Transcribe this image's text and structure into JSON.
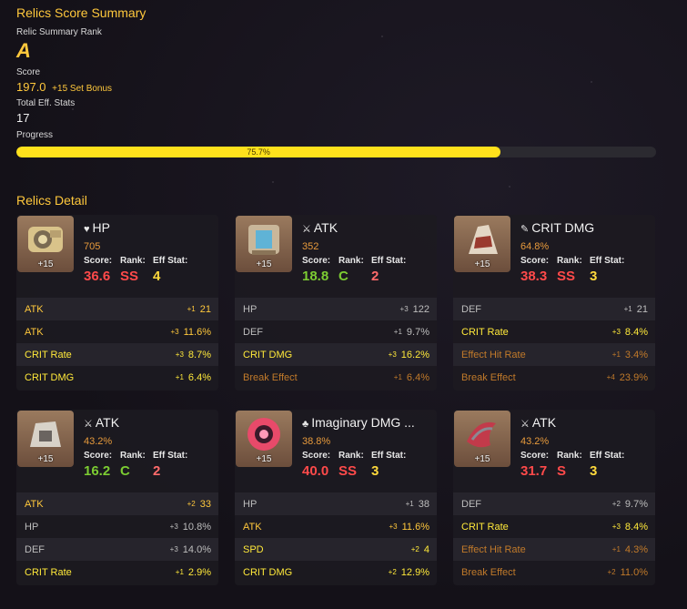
{
  "summary": {
    "title": "Relics Score Summary",
    "rank_label": "Relic Summary Rank",
    "rank": "A",
    "score_label": "Score",
    "score": "197.0",
    "set_bonus": "+15 Set Bonus",
    "eff_label": "Total Eff. Stats",
    "eff_value": "17",
    "progress_label": "Progress",
    "progress_text": "75.7%",
    "progress_fraction": 0.757
  },
  "detail": {
    "title": "Relics Detail",
    "score_hdr": "Score:",
    "rank_hdr": "Rank:",
    "eff_hdr": "Eff Stat:"
  },
  "colors": {
    "accent": "#ffc83c",
    "progress": "#ffe11c"
  },
  "relics": [
    {
      "icon": "heart-icon",
      "icon_glyph": "♥",
      "main": "HP",
      "main_value": "705",
      "level": "+15",
      "score": "36.6",
      "rank": "SS",
      "eff": "4",
      "score_color": "red",
      "rank_color": "red",
      "eff_color": "yellow",
      "subs": [
        {
          "name": "ATK",
          "rolls": "+1",
          "value": "21",
          "color": "gold"
        },
        {
          "name": "ATK",
          "rolls": "+3",
          "value": "11.6%",
          "color": "gold"
        },
        {
          "name": "CRIT Rate",
          "rolls": "+3",
          "value": "8.7%",
          "color": "yellow"
        },
        {
          "name": "CRIT DMG",
          "rolls": "+1",
          "value": "6.4%",
          "color": "yellow"
        }
      ]
    },
    {
      "icon": "sword-icon",
      "icon_glyph": "⚔",
      "main": "ATK",
      "main_value": "352",
      "level": "+15",
      "score": "18.8",
      "rank": "C",
      "eff": "2",
      "score_color": "green",
      "rank_color": "green",
      "eff_color": "pink",
      "subs": [
        {
          "name": "HP",
          "rolls": "+3",
          "value": "122",
          "color": "grey"
        },
        {
          "name": "DEF",
          "rolls": "+1",
          "value": "9.7%",
          "color": "grey"
        },
        {
          "name": "CRIT DMG",
          "rolls": "+3",
          "value": "16.2%",
          "color": "yellow"
        },
        {
          "name": "Break Effect",
          "rolls": "+1",
          "value": "6.4%",
          "color": "dim"
        }
      ]
    },
    {
      "icon": "crit-dmg-icon",
      "icon_glyph": "✎",
      "main": "CRIT DMG",
      "main_value": "64.8%",
      "level": "+15",
      "score": "38.3",
      "rank": "SS",
      "eff": "3",
      "score_color": "red",
      "rank_color": "red",
      "eff_color": "yellow",
      "subs": [
        {
          "name": "DEF",
          "rolls": "+1",
          "value": "21",
          "color": "grey"
        },
        {
          "name": "CRIT Rate",
          "rolls": "+3",
          "value": "8.4%",
          "color": "yellow"
        },
        {
          "name": "Effect Hit Rate",
          "rolls": "+1",
          "value": "3.4%",
          "color": "dim"
        },
        {
          "name": "Break Effect",
          "rolls": "+4",
          "value": "23.9%",
          "color": "dim"
        }
      ]
    },
    {
      "icon": "sword-icon",
      "icon_glyph": "⚔",
      "main": "ATK",
      "main_value": "43.2%",
      "level": "+15",
      "score": "16.2",
      "rank": "C",
      "eff": "2",
      "score_color": "green",
      "rank_color": "green",
      "eff_color": "pink",
      "subs": [
        {
          "name": "ATK",
          "rolls": "+2",
          "value": "33",
          "color": "gold"
        },
        {
          "name": "HP",
          "rolls": "+3",
          "value": "10.8%",
          "color": "grey"
        },
        {
          "name": "DEF",
          "rolls": "+3",
          "value": "14.0%",
          "color": "grey"
        },
        {
          "name": "CRIT Rate",
          "rolls": "+1",
          "value": "2.9%",
          "color": "yellow"
        }
      ]
    },
    {
      "icon": "imaginary-icon",
      "icon_glyph": "♣",
      "main": "Imaginary DMG ...",
      "main_value": "38.8%",
      "level": "+15",
      "score": "40.0",
      "rank": "SS",
      "eff": "3",
      "score_color": "red",
      "rank_color": "red",
      "eff_color": "yellow",
      "subs": [
        {
          "name": "HP",
          "rolls": "+1",
          "value": "38",
          "color": "grey"
        },
        {
          "name": "ATK",
          "rolls": "+3",
          "value": "11.6%",
          "color": "gold"
        },
        {
          "name": "SPD",
          "rolls": "+2",
          "value": "4",
          "color": "yellow"
        },
        {
          "name": "CRIT DMG",
          "rolls": "+2",
          "value": "12.9%",
          "color": "yellow"
        }
      ]
    },
    {
      "icon": "sword-icon",
      "icon_glyph": "⚔",
      "main": "ATK",
      "main_value": "43.2%",
      "level": "+15",
      "score": "31.7",
      "rank": "S",
      "eff": "3",
      "score_color": "red",
      "rank_color": "red",
      "eff_color": "yellow",
      "subs": [
        {
          "name": "DEF",
          "rolls": "+2",
          "value": "9.7%",
          "color": "grey"
        },
        {
          "name": "CRIT Rate",
          "rolls": "+3",
          "value": "8.4%",
          "color": "yellow"
        },
        {
          "name": "Effect Hit Rate",
          "rolls": "+1",
          "value": "4.3%",
          "color": "dim"
        },
        {
          "name": "Break Effect",
          "rolls": "+2",
          "value": "11.0%",
          "color": "dim"
        }
      ]
    }
  ]
}
